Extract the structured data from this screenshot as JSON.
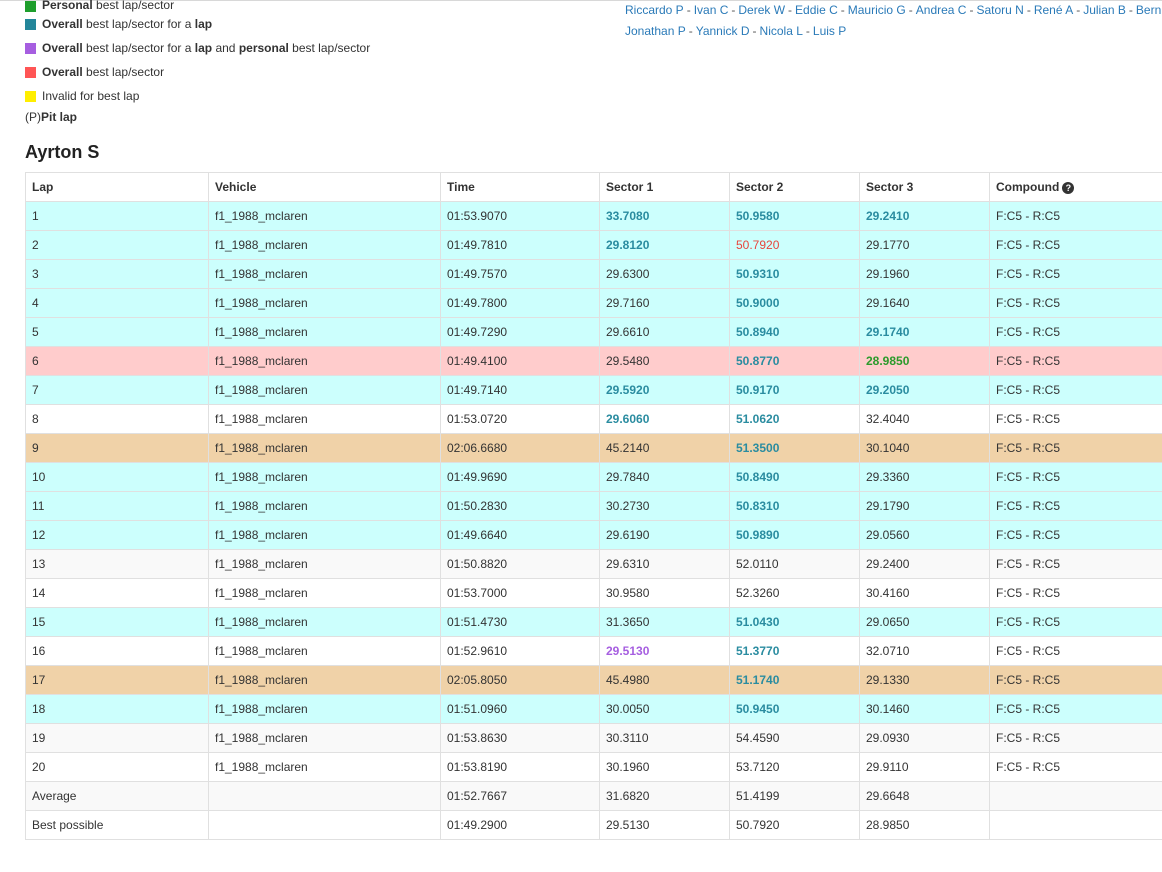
{
  "legend": [
    {
      "bold": "Personal",
      "rest": " best lap/sector",
      "color": "#1e9e2c"
    },
    {
      "bold": "Overall",
      "rest": " best lap/sector for a ",
      "bold2": "lap",
      "color": "#23869a"
    },
    {
      "bold": "Overall",
      "rest": " best lap/sector for a ",
      "bold2": "lap",
      "rest2": " and ",
      "bold3": "personal",
      "rest3": " best lap/sector",
      "color": "#a65ee0"
    },
    {
      "bold": "Overall",
      "rest": " best lap/sector",
      "color": "#ff5555"
    },
    {
      "bold": "",
      "rest": "Invalid for best lap",
      "color": "#ffee00"
    }
  ],
  "pit_legend": {
    "prefix": "(P) ",
    "bold": "Pit lap"
  },
  "drivers_line1": [
    "Riccardo P",
    "Ivan C",
    "Derek W",
    "Eddie C",
    "Mauricio G",
    "Andrea C",
    "Satoru N",
    "René A",
    "Julian B",
    "Bern"
  ],
  "drivers_line2": [
    "Jonathan P",
    "Yannick D",
    "Nicola L",
    "Luis P"
  ],
  "driver_name": "Ayrton S",
  "columns": [
    "Lap",
    "Vehicle",
    "Time",
    "Sector 1",
    "Sector 2",
    "Sector 3",
    "Compound"
  ],
  "rows": [
    {
      "lap": "1",
      "vehicle": "f1_1988_mclaren",
      "time": "01:53.9070",
      "s1": "33.7080",
      "s2": "50.9580",
      "s3": "29.2410",
      "compound": "F:C5 - R:C5",
      "bg": "cyan",
      "s1c": "blue",
      "s2c": "blue",
      "s3c": "blue"
    },
    {
      "lap": "2",
      "vehicle": "f1_1988_mclaren",
      "time": "01:49.7810",
      "s1": "29.8120",
      "s2": "50.7920",
      "s3": "29.1770",
      "compound": "F:C5 - R:C5",
      "bg": "cyan",
      "s1c": "blue",
      "s2c": "red",
      "s3c": ""
    },
    {
      "lap": "3",
      "vehicle": "f1_1988_mclaren",
      "time": "01:49.7570",
      "s1": "29.6300",
      "s2": "50.9310",
      "s3": "29.1960",
      "compound": "F:C5 - R:C5",
      "bg": "cyan",
      "s1c": "",
      "s2c": "blue",
      "s3c": ""
    },
    {
      "lap": "4",
      "vehicle": "f1_1988_mclaren",
      "time": "01:49.7800",
      "s1": "29.7160",
      "s2": "50.9000",
      "s3": "29.1640",
      "compound": "F:C5 - R:C5",
      "bg": "cyan",
      "s1c": "",
      "s2c": "blue",
      "s3c": ""
    },
    {
      "lap": "5",
      "vehicle": "f1_1988_mclaren",
      "time": "01:49.7290",
      "s1": "29.6610",
      "s2": "50.8940",
      "s3": "29.1740",
      "compound": "F:C5 - R:C5",
      "bg": "cyan",
      "s1c": "",
      "s2c": "blue",
      "s3c": "blue"
    },
    {
      "lap": "6",
      "vehicle": "f1_1988_mclaren",
      "time": "01:49.4100",
      "s1": "29.5480",
      "s2": "50.8770",
      "s3": "28.9850",
      "compound": "F:C5 - R:C5",
      "bg": "pink",
      "s1c": "",
      "s2c": "blue",
      "s3c": "green"
    },
    {
      "lap": "7",
      "vehicle": "f1_1988_mclaren",
      "time": "01:49.7140",
      "s1": "29.5920",
      "s2": "50.9170",
      "s3": "29.2050",
      "compound": "F:C5 - R:C5",
      "bg": "cyan",
      "s1c": "blue",
      "s2c": "blue",
      "s3c": "blue"
    },
    {
      "lap": "8",
      "vehicle": "f1_1988_mclaren",
      "time": "01:53.0720",
      "s1": "29.6060",
      "s2": "51.0620",
      "s3": "32.4040",
      "compound": "F:C5 - R:C5",
      "bg": "white",
      "s1c": "blue",
      "s2c": "blue",
      "s3c": ""
    },
    {
      "lap": "9",
      "vehicle": "f1_1988_mclaren",
      "time": "02:06.6680",
      "s1": "45.2140",
      "s2": "51.3500",
      "s3": "30.1040",
      "compound": "F:C5 - R:C5",
      "bg": "tan",
      "s1c": "",
      "s2c": "blue",
      "s3c": ""
    },
    {
      "lap": "10",
      "vehicle": "f1_1988_mclaren",
      "time": "01:49.9690",
      "s1": "29.7840",
      "s2": "50.8490",
      "s3": "29.3360",
      "compound": "F:C5 - R:C5",
      "bg": "cyan",
      "s1c": "",
      "s2c": "blue",
      "s3c": ""
    },
    {
      "lap": "11",
      "vehicle": "f1_1988_mclaren",
      "time": "01:50.2830",
      "s1": "30.2730",
      "s2": "50.8310",
      "s3": "29.1790",
      "compound": "F:C5 - R:C5",
      "bg": "cyan",
      "s1c": "",
      "s2c": "blue",
      "s3c": ""
    },
    {
      "lap": "12",
      "vehicle": "f1_1988_mclaren",
      "time": "01:49.6640",
      "s1": "29.6190",
      "s2": "50.9890",
      "s3": "29.0560",
      "compound": "F:C5 - R:C5",
      "bg": "cyan",
      "s1c": "",
      "s2c": "blue",
      "s3c": ""
    },
    {
      "lap": "13",
      "vehicle": "f1_1988_mclaren",
      "time": "01:50.8820",
      "s1": "29.6310",
      "s2": "52.0110",
      "s3": "29.2400",
      "compound": "F:C5 - R:C5",
      "bg": "grey",
      "s1c": "",
      "s2c": "",
      "s3c": ""
    },
    {
      "lap": "14",
      "vehicle": "f1_1988_mclaren",
      "time": "01:53.7000",
      "s1": "30.9580",
      "s2": "52.3260",
      "s3": "30.4160",
      "compound": "F:C5 - R:C5",
      "bg": "white",
      "s1c": "",
      "s2c": "",
      "s3c": ""
    },
    {
      "lap": "15",
      "vehicle": "f1_1988_mclaren",
      "time": "01:51.4730",
      "s1": "31.3650",
      "s2": "51.0430",
      "s3": "29.0650",
      "compound": "F:C5 - R:C5",
      "bg": "cyan",
      "s1c": "",
      "s2c": "blue",
      "s3c": ""
    },
    {
      "lap": "16",
      "vehicle": "f1_1988_mclaren",
      "time": "01:52.9610",
      "s1": "29.5130",
      "s2": "51.3770",
      "s3": "32.0710",
      "compound": "F:C5 - R:C5",
      "bg": "white",
      "s1c": "purple",
      "s2c": "blue",
      "s3c": ""
    },
    {
      "lap": "17",
      "vehicle": "f1_1988_mclaren",
      "time": "02:05.8050",
      "s1": "45.4980",
      "s2": "51.1740",
      "s3": "29.1330",
      "compound": "F:C5 - R:C5",
      "bg": "tan",
      "s1c": "",
      "s2c": "blue",
      "s3c": ""
    },
    {
      "lap": "18",
      "vehicle": "f1_1988_mclaren",
      "time": "01:51.0960",
      "s1": "30.0050",
      "s2": "50.9450",
      "s3": "30.1460",
      "compound": "F:C5 - R:C5",
      "bg": "cyan",
      "s1c": "",
      "s2c": "blue",
      "s3c": ""
    },
    {
      "lap": "19",
      "vehicle": "f1_1988_mclaren",
      "time": "01:53.8630",
      "s1": "30.3110",
      "s2": "54.4590",
      "s3": "29.0930",
      "compound": "F:C5 - R:C5",
      "bg": "grey",
      "s1c": "",
      "s2c": "",
      "s3c": ""
    },
    {
      "lap": "20",
      "vehicle": "f1_1988_mclaren",
      "time": "01:53.8190",
      "s1": "30.1960",
      "s2": "53.7120",
      "s3": "29.9110",
      "compound": "F:C5 - R:C5",
      "bg": "white",
      "s1c": "",
      "s2c": "",
      "s3c": ""
    },
    {
      "lap": "Average",
      "vehicle": "",
      "time": "01:52.7667",
      "s1": "31.6820",
      "s2": "51.4199",
      "s3": "29.6648",
      "compound": "",
      "bg": "grey",
      "s1c": "",
      "s2c": "",
      "s3c": ""
    },
    {
      "lap": "Best possible",
      "vehicle": "",
      "time": "01:49.2900",
      "s1": "29.5130",
      "s2": "50.7920",
      "s3": "28.9850",
      "compound": "",
      "bg": "white",
      "s1c": "",
      "s2c": "",
      "s3c": ""
    }
  ],
  "icons": {
    "compound_help": "question-circle-icon"
  }
}
